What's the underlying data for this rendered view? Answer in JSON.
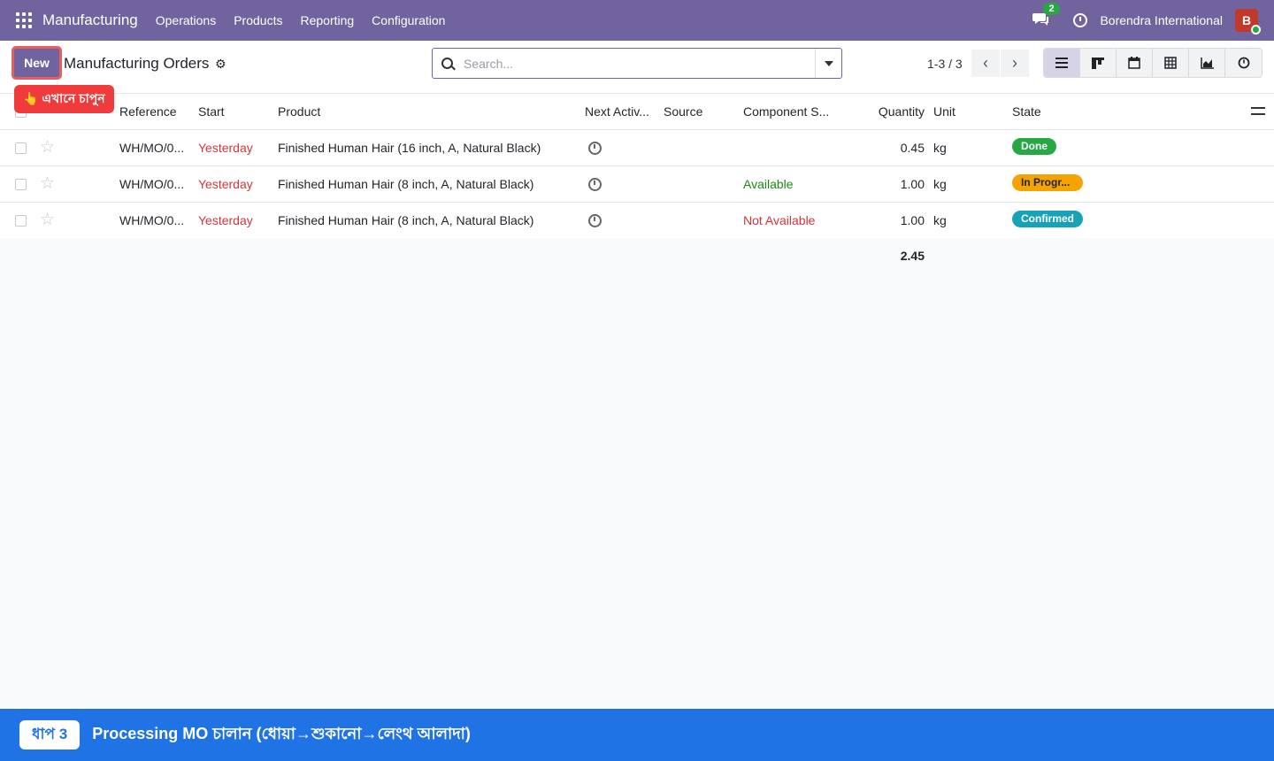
{
  "navbar": {
    "brand": "Manufacturing",
    "menu": [
      "Operations",
      "Products",
      "Reporting",
      "Configuration"
    ],
    "chat_badge": "2",
    "company": "Borendra International",
    "avatar_letter": "B"
  },
  "control": {
    "new_label": "New",
    "title": "Manufacturing Orders",
    "tooltip": "👆 এখানে চাপুন",
    "search_placeholder": "Search...",
    "pager": "1-3 / 3",
    "pager_prev": "‹",
    "pager_next": "›"
  },
  "table": {
    "columns": {
      "reference": "Reference",
      "start": "Start",
      "product": "Product",
      "next_activity": "Next Activ...",
      "source": "Source",
      "component_status": "Component S...",
      "quantity": "Quantity",
      "unit": "Unit",
      "state": "State"
    },
    "rows": [
      {
        "reference": "WH/MO/0...",
        "start": "Yesterday",
        "product": "Finished Human Hair (16 inch, A, Natural Black)",
        "component_status": "",
        "quantity": "0.45",
        "unit": "kg",
        "state": "Done"
      },
      {
        "reference": "WH/MO/0...",
        "start": "Yesterday",
        "product": "Finished Human Hair (8 inch, A, Natural Black)",
        "component_status": "Available",
        "quantity": "1.00",
        "unit": "kg",
        "state": "In Progr..."
      },
      {
        "reference": "WH/MO/0...",
        "start": "Yesterday",
        "product": "Finished Human Hair (8 inch, A, Natural Black)",
        "component_status": "Not Available",
        "quantity": "1.00",
        "unit": "kg",
        "state": "Confirmed"
      }
    ],
    "total_quantity": "2.45"
  },
  "banner": {
    "step": "ধাপ 3",
    "text": "Processing MO চালান (ধোয়া→শুকানো→লেংথ আলাদা)"
  },
  "colors": {
    "navbar": "#71639e",
    "banner": "#1f73e5",
    "done": "#28a745",
    "in_progress": "#f5a300",
    "confirmed": "#17a2b8",
    "late_red": "#d9343a",
    "available_green": "#1a8a1a"
  }
}
